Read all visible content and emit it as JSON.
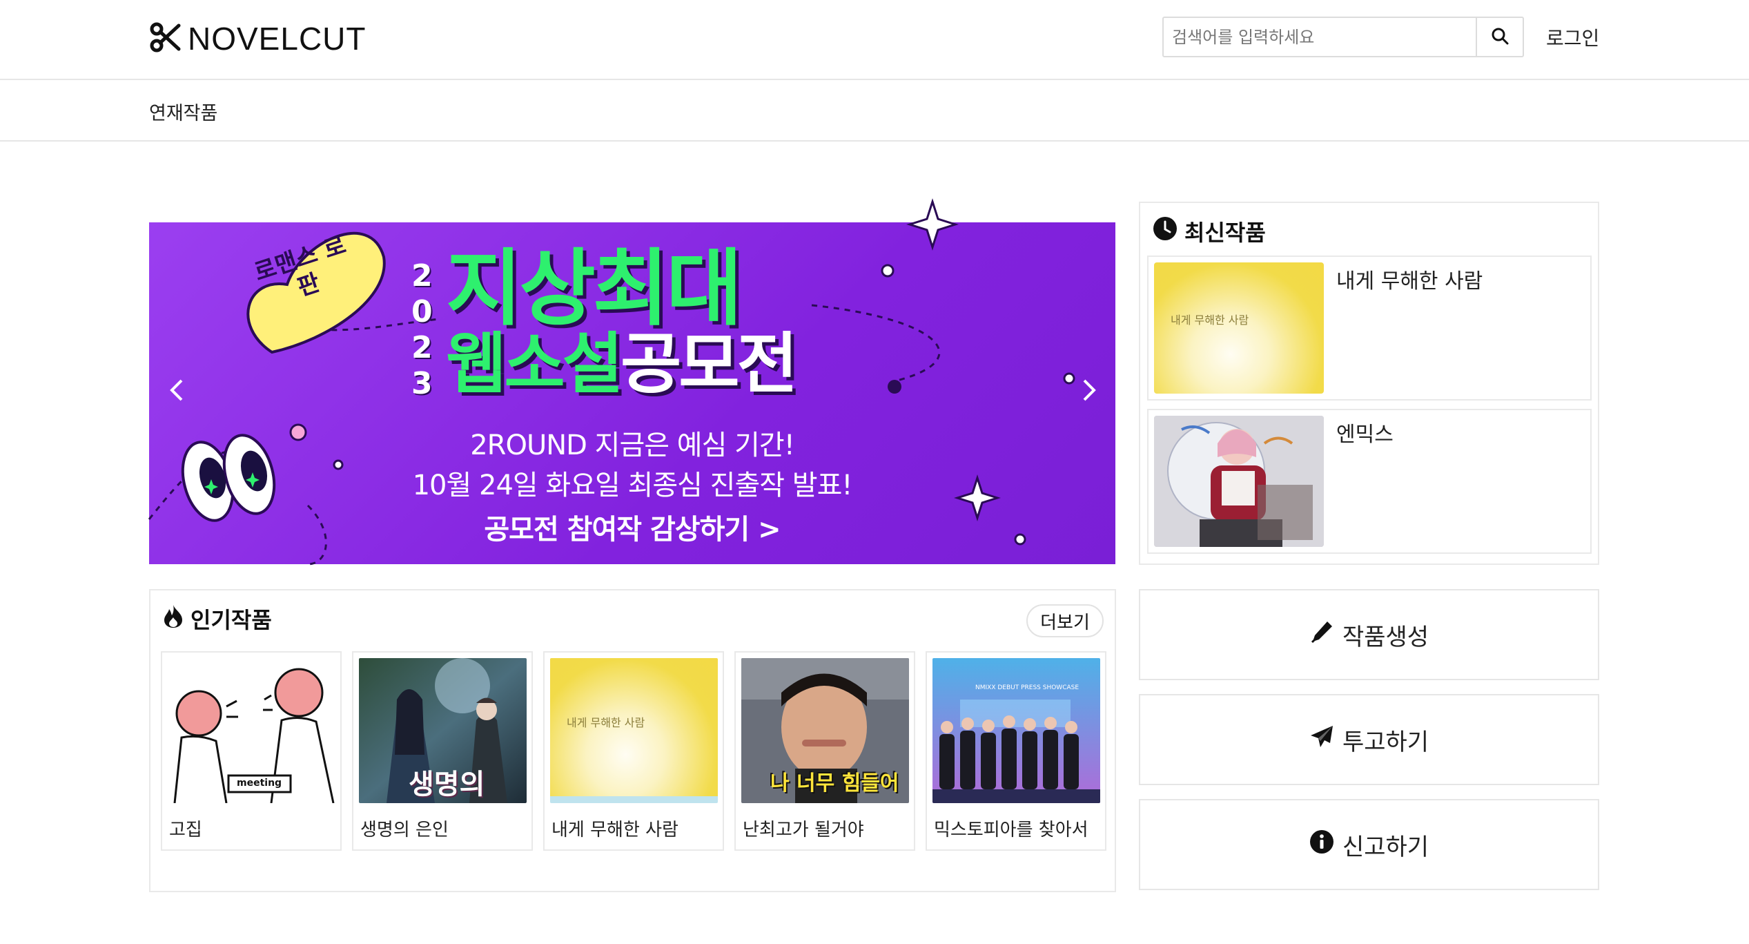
{
  "header": {
    "logo_text": "NOVELCUT",
    "search_placeholder": "검색어를 입력하세요",
    "login_label": "로그인"
  },
  "subnav": {
    "items": [
      "연재작품"
    ]
  },
  "banner": {
    "badge": "로맨스 로판",
    "year": "2023",
    "headline_line1": "지상최대",
    "headline_line2a": "웹소설",
    "headline_line2b": "공모전",
    "line1": "2ROUND 지금은 예심 기간!",
    "line2": "10월 24일 화요일 최종심 진출작 발표!",
    "cta": "공모전 참여작 감상하기 >"
  },
  "latest": {
    "title": "최신작품",
    "items": [
      {
        "name": "내게 무해한 사람",
        "cover_text": "내게 무해한 사람"
      },
      {
        "name": "엔믹스"
      }
    ]
  },
  "popular": {
    "title": "인기작품",
    "more_label": "더보기",
    "items": [
      {
        "name": "고집",
        "cover_text": "meeting"
      },
      {
        "name": "생명의 은인",
        "cover_text": "생명의"
      },
      {
        "name": "내게 무해한 사람",
        "cover_text": "내게 무해한 사람"
      },
      {
        "name": "난최고가 될거야",
        "cover_text": "나 너무 힘들어"
      },
      {
        "name": "믹스토피아를 찾아서",
        "cover_text": "NMIXX DEBUT PRESS SHOWCASE"
      }
    ]
  },
  "actions": {
    "create": "작품생성",
    "submit": "투고하기",
    "report": "신고하기"
  },
  "colors": {
    "banner_purple": "#8a2be2",
    "banner_green": "#2ef06e"
  }
}
